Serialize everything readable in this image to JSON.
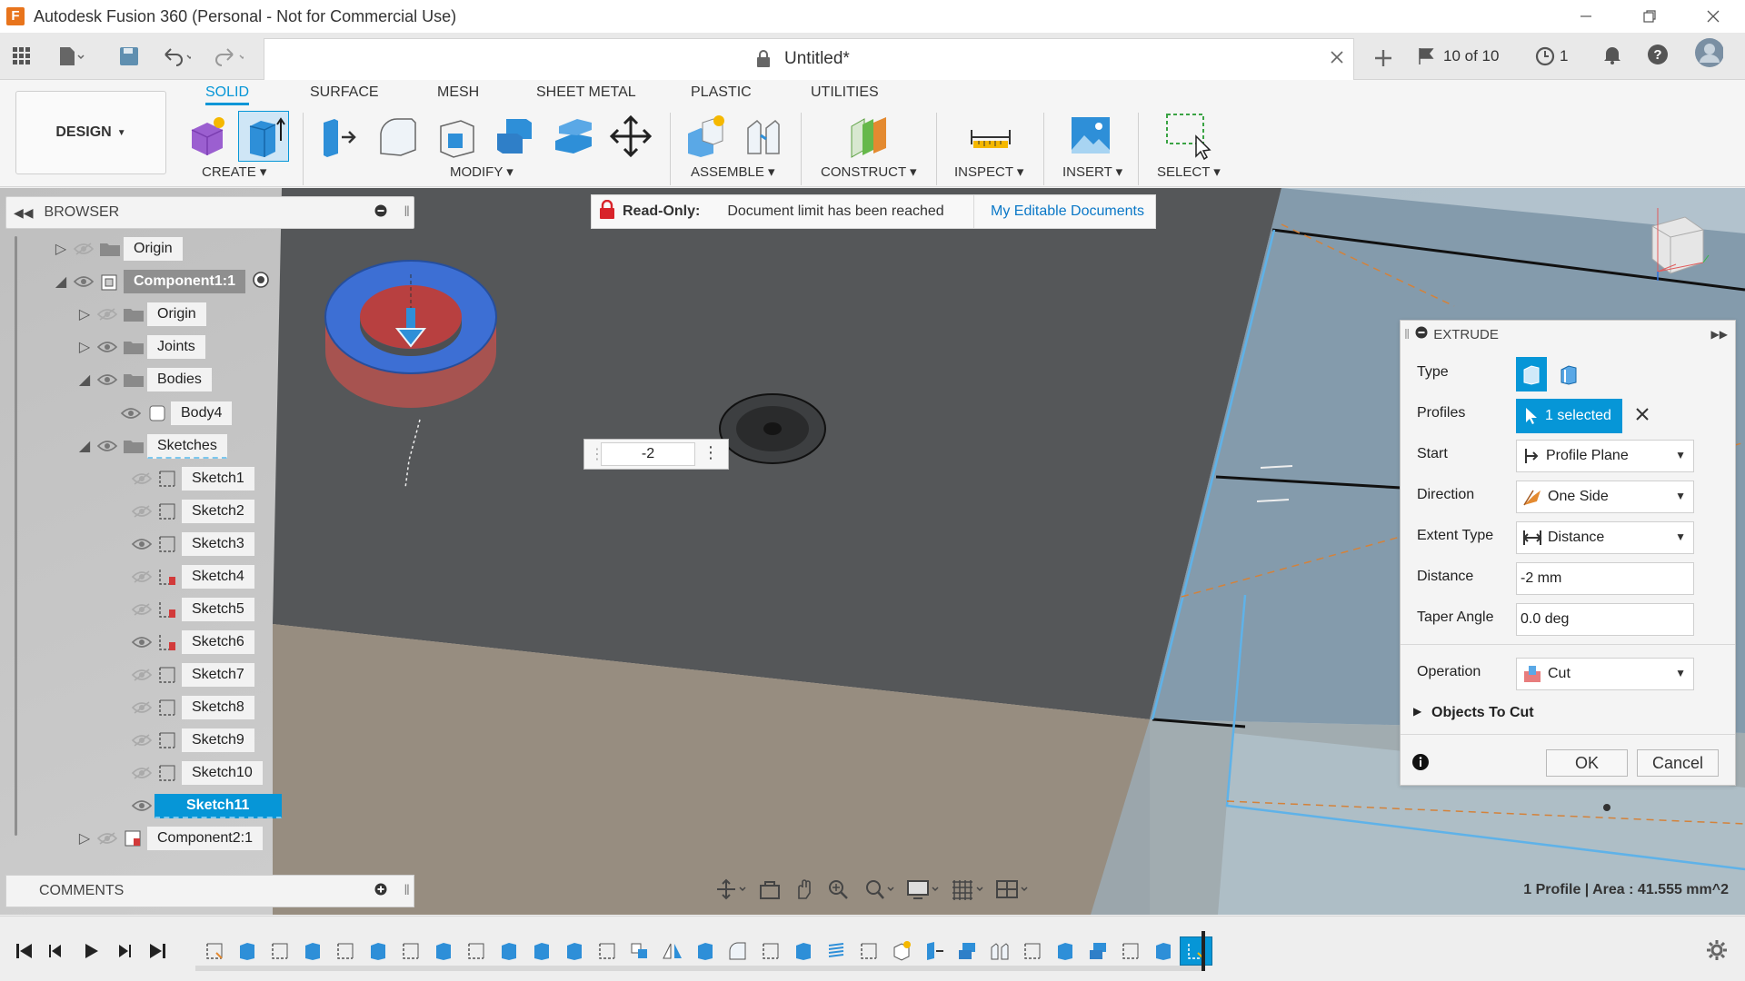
{
  "window": {
    "title": "Autodesk Fusion 360 (Personal - Not for Commercial Use)",
    "app_icon_letter": "F"
  },
  "document": {
    "title": "Untitled*",
    "version_count": "10 of 10",
    "job_count": "1"
  },
  "ribbon": {
    "workspace": "DESIGN",
    "tabs": [
      "SOLID",
      "SURFACE",
      "MESH",
      "SHEET METAL",
      "PLASTIC",
      "UTILITIES"
    ],
    "groups": [
      "CREATE",
      "MODIFY",
      "ASSEMBLE",
      "CONSTRUCT",
      "INSPECT",
      "INSERT",
      "SELECT"
    ]
  },
  "banner": {
    "label": "Read-Only:",
    "message": "Document limit has been reached",
    "link": "My Editable Documents"
  },
  "browser": {
    "title": "BROWSER",
    "items": [
      {
        "label": "Origin"
      },
      {
        "label": "Component1:1"
      },
      {
        "label": "Origin"
      },
      {
        "label": "Joints"
      },
      {
        "label": "Bodies"
      },
      {
        "label": "Body4"
      },
      {
        "label": "Sketches"
      },
      {
        "label": "Sketch1"
      },
      {
        "label": "Sketch2"
      },
      {
        "label": "Sketch3"
      },
      {
        "label": "Sketch4"
      },
      {
        "label": "Sketch5"
      },
      {
        "label": "Sketch6"
      },
      {
        "label": "Sketch7"
      },
      {
        "label": "Sketch8"
      },
      {
        "label": "Sketch9"
      },
      {
        "label": "Sketch10"
      },
      {
        "label": "Sketch11"
      },
      {
        "label": "Component2:1"
      }
    ]
  },
  "viewport": {
    "distance_value": "-2"
  },
  "extrude": {
    "title": "EXTRUDE",
    "type_label": "Type",
    "profiles_label": "Profiles",
    "profiles_value": "1 selected",
    "start_label": "Start",
    "start_value": "Profile Plane",
    "direction_label": "Direction",
    "direction_value": "One Side",
    "extent_label": "Extent Type",
    "extent_value": "Distance",
    "distance_label": "Distance",
    "distance_value": "-2 mm",
    "taper_label": "Taper Angle",
    "taper_value": "0.0 deg",
    "operation_label": "Operation",
    "operation_value": "Cut",
    "objects_label": "Objects To Cut",
    "ok": "OK",
    "cancel": "Cancel"
  },
  "comments": {
    "title": "COMMENTS"
  },
  "status": {
    "text": "1 Profile | Area : 41.555 mm^2"
  },
  "colors": {
    "accent": "#0696d7",
    "cut_red": "#b84a4a",
    "face_blue": "#3d6fd4"
  }
}
